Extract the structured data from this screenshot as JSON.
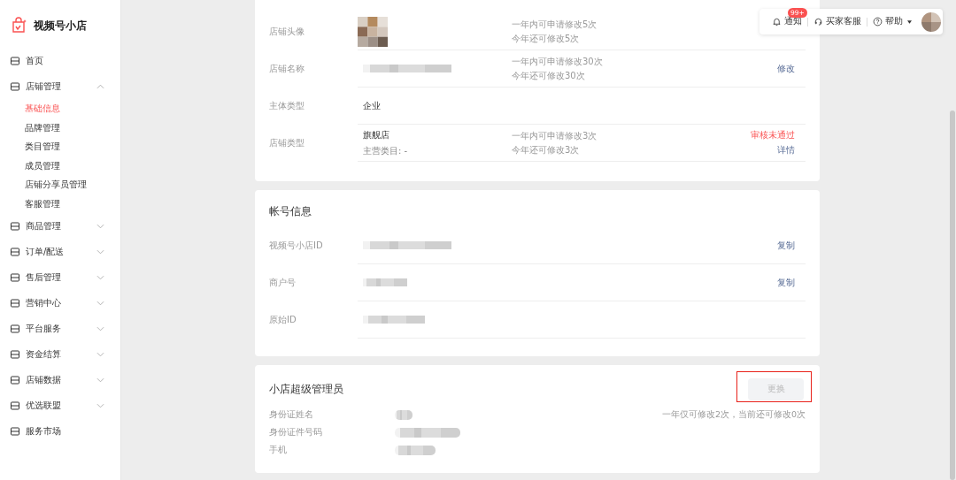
{
  "logo": {
    "title": "视频号小店"
  },
  "sidebar": {
    "items": [
      {
        "label": "首页",
        "kind": "link"
      },
      {
        "label": "店铺管理",
        "kind": "group",
        "expanded": true,
        "children": [
          {
            "label": "基础信息",
            "selected": true
          },
          {
            "label": "品牌管理",
            "selected": false
          },
          {
            "label": "类目管理",
            "selected": false
          },
          {
            "label": "成员管理",
            "selected": false
          },
          {
            "label": "店铺分享员管理",
            "selected": false
          },
          {
            "label": "客服管理",
            "selected": false
          }
        ]
      },
      {
        "label": "商品管理",
        "kind": "group",
        "expanded": false
      },
      {
        "label": "订单/配送",
        "kind": "group",
        "expanded": false
      },
      {
        "label": "售后管理",
        "kind": "group",
        "expanded": false
      },
      {
        "label": "营销中心",
        "kind": "group",
        "expanded": false
      },
      {
        "label": "平台服务",
        "kind": "group",
        "expanded": false
      },
      {
        "label": "资金结算",
        "kind": "group",
        "expanded": false
      },
      {
        "label": "店铺数据",
        "kind": "group",
        "expanded": false
      },
      {
        "label": "优选联盟",
        "kind": "group",
        "expanded": false
      },
      {
        "label": "服务市场",
        "kind": "link"
      }
    ]
  },
  "topbar": {
    "notifications": {
      "label": "通知",
      "badge": "99+"
    },
    "service": {
      "label": "买家客服"
    },
    "help": {
      "label": "帮助"
    }
  },
  "basic_info": {
    "rows": [
      {
        "label": "店铺头像",
        "kind": "avatar",
        "notes": [
          "一年内可申请修改5次",
          "今年还可修改5次"
        ]
      },
      {
        "label": "店铺名称",
        "kind": "blurred",
        "notes": [
          "一年内可申请修改30次",
          "今年还可修改30次"
        ],
        "actions": [
          {
            "label": "修改",
            "kind": "link"
          }
        ]
      },
      {
        "label": "主体类型",
        "kind": "text",
        "values": [
          "企业"
        ]
      },
      {
        "label": "店铺类型",
        "kind": "text",
        "values": [
          "旗舰店",
          "主营类目: -"
        ],
        "notes": [
          "一年内可申请修改3次",
          "今年还可修改3次"
        ],
        "actions": [
          {
            "label": "审核未通过",
            "kind": "alert"
          },
          {
            "label": "详情",
            "kind": "link"
          }
        ]
      }
    ]
  },
  "account_info": {
    "title": "帐号信息",
    "rows": [
      {
        "label": "视频号小店ID",
        "actions": [
          {
            "label": "复制"
          }
        ]
      },
      {
        "label": "商户号",
        "actions": [
          {
            "label": "复制"
          }
        ]
      },
      {
        "label": "原始ID"
      }
    ]
  },
  "super_admin": {
    "title": "小店超级管理员",
    "button": {
      "label": "更换",
      "disabled": true,
      "highlighted": true
    },
    "note": "一年仅可修改2次，当前还可修改0次",
    "fields": [
      {
        "label": "身份证姓名"
      },
      {
        "label": "身份证件号码"
      },
      {
        "label": "手机"
      }
    ]
  }
}
